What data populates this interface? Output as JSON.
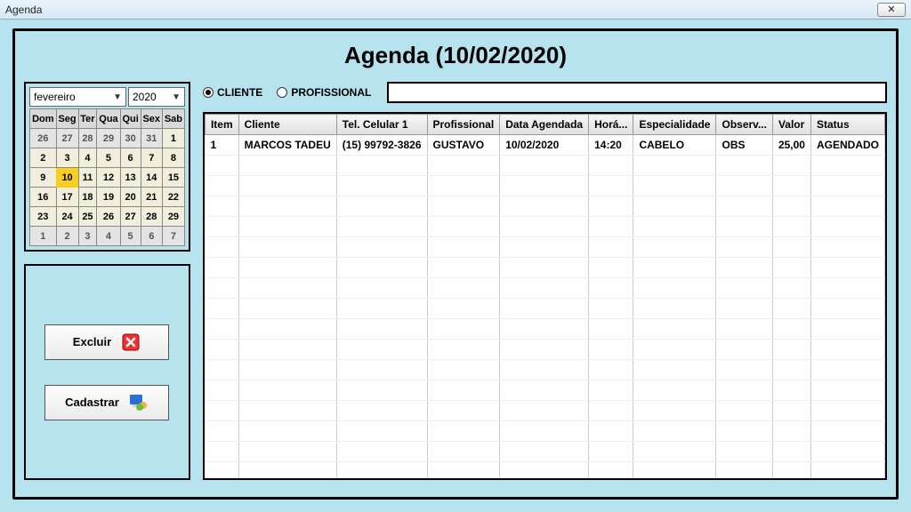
{
  "window": {
    "title": "Agenda"
  },
  "page_title": "Agenda (10/02/2020)",
  "calendar": {
    "month_label": "fevereiro",
    "year_label": "2020",
    "day_headers": [
      "Dom",
      "Seg",
      "Ter",
      "Qua",
      "Qui",
      "Sex",
      "Sab"
    ],
    "weeks": [
      [
        {
          "d": "26",
          "o": true
        },
        {
          "d": "27",
          "o": true
        },
        {
          "d": "28",
          "o": true
        },
        {
          "d": "29",
          "o": true
        },
        {
          "d": "30",
          "o": true
        },
        {
          "d": "31",
          "o": true
        },
        {
          "d": "1"
        }
      ],
      [
        {
          "d": "2"
        },
        {
          "d": "3"
        },
        {
          "d": "4"
        },
        {
          "d": "5"
        },
        {
          "d": "6"
        },
        {
          "d": "7"
        },
        {
          "d": "8"
        }
      ],
      [
        {
          "d": "9"
        },
        {
          "d": "10",
          "sel": true
        },
        {
          "d": "11"
        },
        {
          "d": "12"
        },
        {
          "d": "13"
        },
        {
          "d": "14"
        },
        {
          "d": "15"
        }
      ],
      [
        {
          "d": "16"
        },
        {
          "d": "17"
        },
        {
          "d": "18"
        },
        {
          "d": "19"
        },
        {
          "d": "20"
        },
        {
          "d": "21"
        },
        {
          "d": "22"
        }
      ],
      [
        {
          "d": "23"
        },
        {
          "d": "24"
        },
        {
          "d": "25"
        },
        {
          "d": "26"
        },
        {
          "d": "27"
        },
        {
          "d": "28"
        },
        {
          "d": "29"
        }
      ],
      [
        {
          "d": "1",
          "o": true
        },
        {
          "d": "2",
          "o": true
        },
        {
          "d": "3",
          "o": true
        },
        {
          "d": "4",
          "o": true
        },
        {
          "d": "5",
          "o": true
        },
        {
          "d": "6",
          "o": true
        },
        {
          "d": "7",
          "o": true
        }
      ]
    ]
  },
  "actions": {
    "excluir": "Excluir",
    "cadastrar": "Cadastrar"
  },
  "filter": {
    "cliente_label": "CLIENTE",
    "profissional_label": "PROFISSIONAL",
    "selected": "cliente",
    "search_value": ""
  },
  "grid": {
    "columns": [
      "Item",
      "Cliente",
      "Tel. Celular 1",
      "Profissional",
      "Data Agendada",
      "Horá...",
      "Especialidade",
      "Observ...",
      "Valor",
      "Status"
    ],
    "rows": [
      {
        "item": "1",
        "cliente": "MARCOS TADEU",
        "tel": "(15) 99792-3826",
        "prof": "GUSTAVO",
        "data": "10/02/2020",
        "hora": "14:20",
        "esp": "CABELO",
        "obs": "OBS",
        "valor": "25,00",
        "status": "AGENDADO"
      }
    ]
  }
}
